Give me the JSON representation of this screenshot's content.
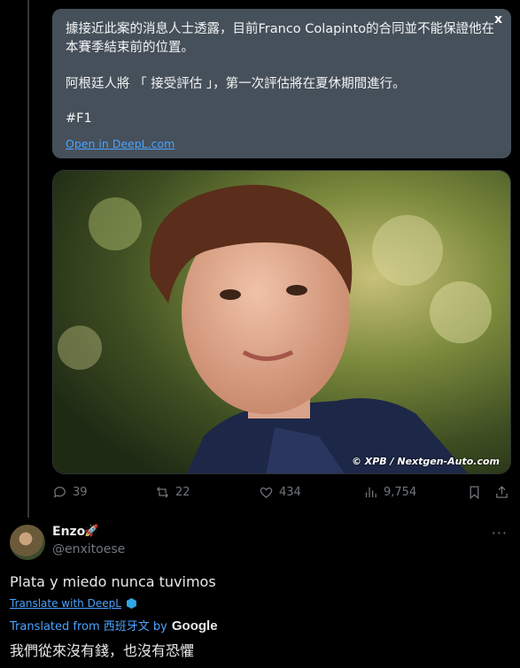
{
  "translation_card": {
    "close": "x",
    "paragraph1": "據接近此案的消息人士透露，目前Franco Colapinto的合同並不能保證他在本賽季結束前的位置。",
    "paragraph2": "阿根廷人將 「 接受評估 」，第一次評估將在夏休期間進行。",
    "hashtag": "#F1",
    "link": "Open in DeepL.com"
  },
  "photo": {
    "watermark": "© XPB / Nextgen-Auto.com"
  },
  "actions": {
    "replies": "39",
    "reposts": "22",
    "likes": "434",
    "views": "9,754"
  },
  "reply": {
    "display_name": "Enzo",
    "emoji": "🚀",
    "handle": "@enxitoese",
    "more": "···",
    "text": "Plata y miedo nunca tuvimos",
    "translate_link": "Translate with DeepL",
    "translated_from": "Translated from 西班牙文 by",
    "google": "Google",
    "translated_text": "我們從來沒有錢，也沒有恐懼"
  }
}
